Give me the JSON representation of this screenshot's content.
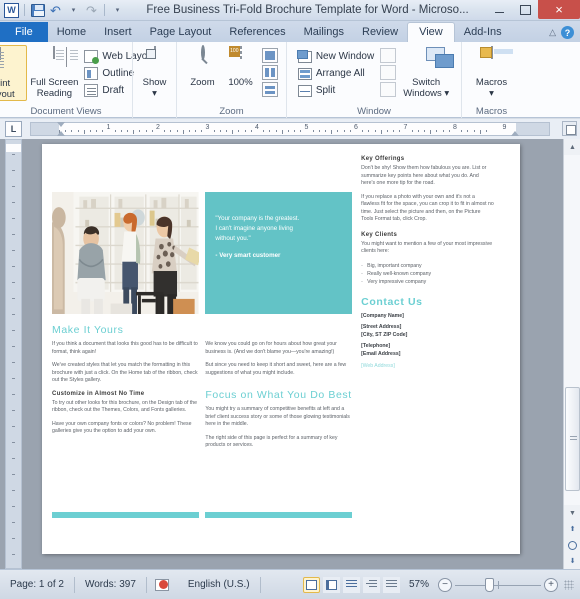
{
  "window": {
    "app_icon": "word-icon",
    "title": "Free Business Tri-Fold Brochure Template for Word  -  Microso...",
    "quick_access": [
      {
        "name": "save-icon",
        "label": "Save"
      },
      {
        "name": "undo-icon",
        "label": "Undo"
      },
      {
        "name": "redo-icon",
        "label": "Redo"
      },
      {
        "name": "customize-qat-icon",
        "label": "Customize Quick Access Toolbar"
      }
    ],
    "minimize": "–",
    "maximize": "□",
    "close": "×"
  },
  "ribbon": {
    "tabs": [
      {
        "label": "File",
        "active": false,
        "file": true
      },
      {
        "label": "Home",
        "active": false
      },
      {
        "label": "Insert",
        "active": false
      },
      {
        "label": "Page Layout",
        "active": false
      },
      {
        "label": "References",
        "active": false
      },
      {
        "label": "Mailings",
        "active": false
      },
      {
        "label": "Review",
        "active": false
      },
      {
        "label": "View",
        "active": true
      },
      {
        "label": "Add-Ins",
        "active": false
      }
    ],
    "minimize_ribbon_icon": "chevron-up-icon",
    "help_icon": "help-icon",
    "groups": [
      {
        "name": "Document Views",
        "label": "Document Views",
        "big_buttons": [
          {
            "label": "Print Layout",
            "line1": "Print",
            "line2": "Layout",
            "selected": true
          },
          {
            "label": "Full Screen Reading",
            "line1": "Full Screen",
            "line2": "Reading",
            "selected": false
          }
        ],
        "small_buttons": [
          {
            "label": "Web Layout"
          },
          {
            "label": "Outline"
          },
          {
            "label": "Draft"
          }
        ]
      },
      {
        "name": "Show",
        "label": "",
        "big_buttons": [
          {
            "label": "Show",
            "line1": "Show",
            "line2": "▾",
            "selected": false
          }
        ]
      },
      {
        "name": "Zoom",
        "label": "Zoom",
        "big_buttons": [
          {
            "label": "Zoom",
            "line1": "Zoom",
            "line2": "",
            "selected": false
          },
          {
            "label": "100%",
            "line1": "100%",
            "line2": "",
            "selected": false
          }
        ]
      },
      {
        "name": "Window",
        "label": "Window",
        "small_buttons": [
          {
            "label": "New Window"
          },
          {
            "label": "Arrange All"
          },
          {
            "label": "Split"
          }
        ],
        "big_buttons": [
          {
            "label": "Switch Windows",
            "line1": "Switch",
            "line2": "Windows ▾",
            "selected": false
          }
        ]
      },
      {
        "name": "Macros",
        "label": "Macros",
        "big_buttons": [
          {
            "label": "Macros",
            "line1": "Macros",
            "line2": "▾",
            "selected": false
          }
        ]
      }
    ]
  },
  "ruler": {
    "tab_selector": "L",
    "numbers": [
      "1",
      "2",
      "3",
      "4",
      "5",
      "6",
      "7",
      "8",
      "9"
    ],
    "toggle_icon": "show-ruler-icon"
  },
  "document": {
    "left_column": {
      "photo_alt": "three people in a retail boutique",
      "heading": "Make It Yours",
      "paragraphs": [
        "If you think a document that looks this good has to be difficult to format, think again!",
        "We've created styles that let you match the formatting in this brochure with just a click. On the Home tab of the ribbon, check out the Styles gallery."
      ],
      "subheading": "Customize in Almost No Time",
      "sub_paragraphs": [
        "To try out other looks for this brochure, on the Design tab of the ribbon, check out the Themes, Colors, and Fonts galleries.",
        "Have your own company fonts or colors? No problem! These galleries give you the option to add your own."
      ]
    },
    "middle_column": {
      "quote": "\"Your company  is the greatest.\nI can't  imagine anyone  living\nwithout you.\"",
      "quote_attribution": "- Very smart  customer",
      "paragraphs": [
        "We know you could go on for hours about how great your business is. (And we don't blame you—you're amazing!)",
        "But since you need to keep it short and sweet, here are a few suggestions of what you might include."
      ],
      "heading": "Focus on What You Do Best",
      "after_paragraphs": [
        "You might try a summary of competitive benefits at left and a brief client success story or some of those glowing testimonials here in the middle.",
        "The right side of this page is perfect for a summary of key products or services."
      ]
    },
    "right_column": {
      "subheading1": "Key Offerings",
      "paragraphs1": [
        "Don't be shy! Show them how fabulous you are. List or summarize key points here about what you do. And here's one more tip for the road.",
        "If you replace a photo with your own and it's not a flawless fit for the space, you can crop it to fit in almost no time. Just select the picture and then, on the Picture Tools Format tab, click Crop."
      ],
      "subheading2": "Key Clients",
      "paragraphs2": [
        "You might want to mention a few of your most impressive clients here:"
      ],
      "bullets": [
        "Big, important company",
        "Really well-known company",
        "Very impressive company"
      ],
      "contact_heading": "Contact Us",
      "contact_lines": [
        "[Company Name]",
        "[Street Address]",
        "[City, ST  ZIP Code]",
        "[Telephone]",
        "[Email Address]"
      ],
      "web_address": "[Web Address]"
    }
  },
  "scrollbar": {
    "up_arrow": "▲",
    "down_arrow": "▼",
    "previous_page": "⬆",
    "select_browse_object": "browse-object-icon",
    "next_page": "⬇"
  },
  "status_bar": {
    "page": "Page: 1 of 2",
    "words": "Words: 397",
    "proofing_icon": "proofing-errors-icon",
    "language": "English (U.S.)",
    "view_buttons": [
      {
        "name": "print-layout-view",
        "selected": true
      },
      {
        "name": "full-screen-reading-view",
        "selected": false
      },
      {
        "name": "web-layout-view",
        "selected": false
      },
      {
        "name": "outline-view",
        "selected": false
      },
      {
        "name": "draft-view",
        "selected": false
      }
    ],
    "zoom_level": "57%",
    "zoom_out": "−",
    "zoom_in": "+"
  },
  "colors": {
    "accent_teal": "#6ccfd2",
    "quote_bg": "#63c3c6",
    "file_tab_blue": "#1f6fc4",
    "close_red": "#c8504a",
    "selection_gold": "#fdf3cf"
  }
}
